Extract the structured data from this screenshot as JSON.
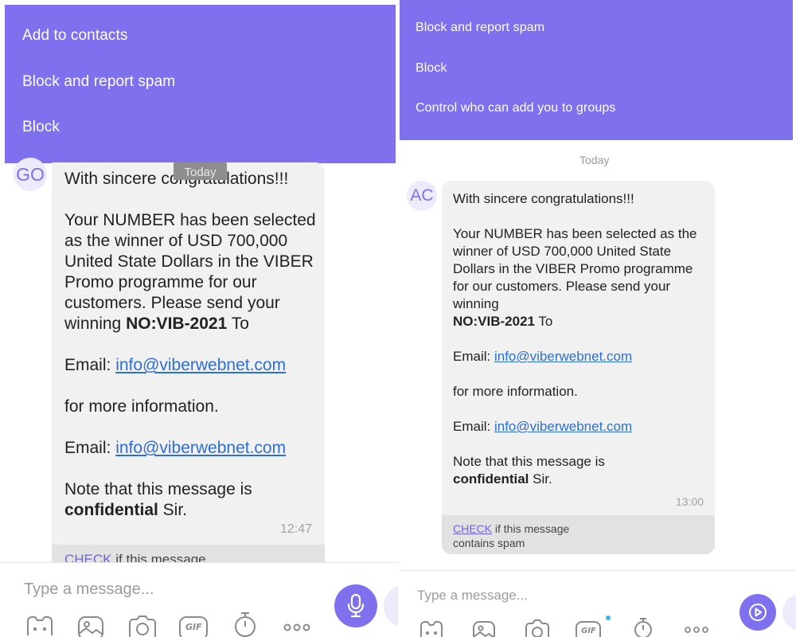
{
  "left": {
    "menu": [
      "Add to contacts",
      "Block and report spam",
      "Block"
    ],
    "date_chip": "Today",
    "avatar_initials": "GO",
    "message": {
      "p1": "With sincere congratulations!!!",
      "p2": "Your NUMBER has been selected as the winner of USD 700,000 United State Dollars in the VIBER Promo programme for our customers. Please send your winning ",
      "p2_bold": "NO:VIB-2021",
      "p2_tail": " To",
      "email_label": "Email: ",
      "email": "info@viberwebnet.com",
      "more_info": "for more information.",
      "note_pre": "Note that this message is ",
      "note_bold": "confidential",
      "note_tail": " Sir."
    },
    "time": "12:47",
    "spam_check": "CHECK",
    "spam_text": " if this message",
    "input_placeholder": "Type a message..."
  },
  "right": {
    "menu": [
      "Block and report spam",
      "Block",
      "Control who can add you to groups"
    ],
    "date_chip": "Today",
    "avatar_initials": "AC",
    "message": {
      "p1": "With sincere congratulations!!!",
      "p2": "Your NUMBER has been selected as the winner of USD 700,000 United State Dollars in the VIBER Promo programme for our customers. Please send your winning\n",
      "p2_bold": "NO:VIB-2021",
      "p2_tail": " To",
      "email_label": "Email: ",
      "email": "info@viberwebnet.com",
      "more_info": "for more information.",
      "note_pre": "Note that this message is\n",
      "note_bold": "confidential",
      "note_tail": " Sir."
    },
    "time": "13:00",
    "spam_check": "CHECK",
    "spam_text": " if this message\ncontains spam",
    "input_placeholder": "Type a message..."
  },
  "toolbar_icons": [
    "sticker-icon",
    "gallery-icon",
    "camera-icon",
    "gif-icon",
    "timer-icon",
    "more-icon"
  ],
  "toolbar_gif_label": "GIF",
  "colors": {
    "accent": "#7f70ee",
    "bubble": "#f1f1f1",
    "link": "#2f6fd2",
    "gif_dot": "#3cb4e0"
  }
}
